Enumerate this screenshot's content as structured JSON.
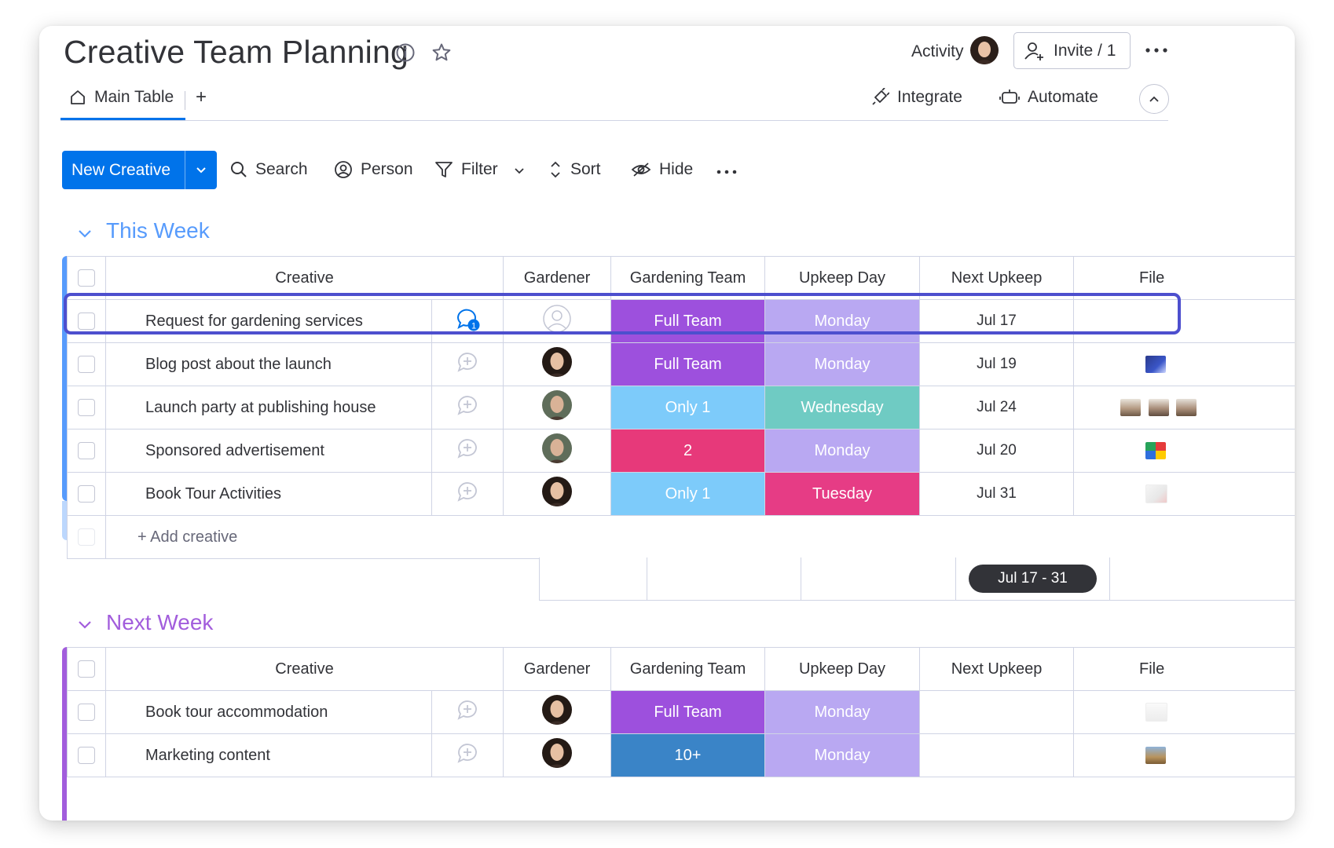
{
  "header": {
    "title": "Creative Team Planning",
    "activity_label": "Activity",
    "invite_label": "Invite / 1"
  },
  "tabs": {
    "main_table": "Main Table",
    "add": "+",
    "integrate": "Integrate",
    "automate": "Automate"
  },
  "toolbar": {
    "new_item": "New Creative",
    "search": "Search",
    "person": "Person",
    "filter": "Filter",
    "sort": "Sort",
    "hide": "Hide"
  },
  "columns": [
    "Creative",
    "Gardener",
    "Gardening Team",
    "Upkeep Day",
    "Next Upkeep",
    "File"
  ],
  "groups": [
    {
      "title": "This Week",
      "color": "#579bfc",
      "add_label": "+ Add creative",
      "summary_date_range": "Jul 17 - 31",
      "rows": [
        {
          "name": "Request for gardening services",
          "updates": "1",
          "team": "Full Team",
          "team_color": "#9d50dd",
          "day": "Monday",
          "day_color": "#b9a8f2",
          "date": "Jul 17"
        },
        {
          "name": "Blog post about the launch",
          "team": "Full Team",
          "team_color": "#9d50dd",
          "day": "Monday",
          "day_color": "#b9a8f2",
          "date": "Jul 19"
        },
        {
          "name": "Launch party at publishing house",
          "team": "Only 1",
          "team_color": "#7dcbfa",
          "day": "Wednesday",
          "day_color": "#6fcbc3",
          "date": "Jul 24"
        },
        {
          "name": "Sponsored advertisement",
          "team": "2",
          "team_color": "#e7397a",
          "day": "Monday",
          "day_color": "#b9a8f2",
          "date": "Jul 20"
        },
        {
          "name": "Book Tour Activities",
          "team": "Only 1",
          "team_color": "#7dcbfa",
          "day": "Tuesday",
          "day_color": "#e63c85",
          "date": "Jul 31"
        }
      ]
    },
    {
      "title": "Next Week",
      "color": "#a25ddc",
      "rows": [
        {
          "name": "Book tour accommodation",
          "team": "Full Team",
          "team_color": "#9d50dd",
          "day": "Monday",
          "day_color": "#b9a8f2",
          "date": ""
        },
        {
          "name": "Marketing content",
          "team": "10+",
          "team_color": "#3a84c7",
          "day": "Monday",
          "day_color": "#b9a8f2",
          "date": ""
        }
      ]
    }
  ]
}
